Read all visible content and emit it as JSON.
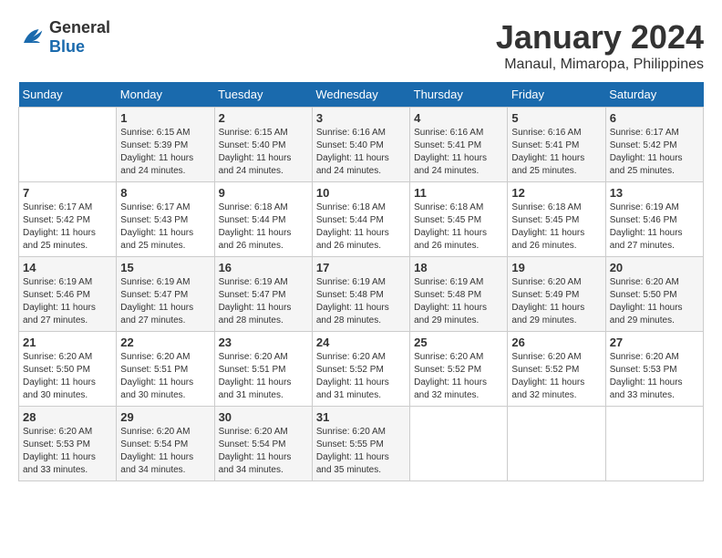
{
  "header": {
    "logo_general": "General",
    "logo_blue": "Blue",
    "month_title": "January 2024",
    "location": "Manaul, Mimaropa, Philippines"
  },
  "days_of_week": [
    "Sunday",
    "Monday",
    "Tuesday",
    "Wednesday",
    "Thursday",
    "Friday",
    "Saturday"
  ],
  "weeks": [
    [
      {
        "num": "",
        "sunrise": "",
        "sunset": "",
        "daylight": ""
      },
      {
        "num": "1",
        "sunrise": "6:15 AM",
        "sunset": "5:39 PM",
        "daylight": "11 hours and 24 minutes."
      },
      {
        "num": "2",
        "sunrise": "6:15 AM",
        "sunset": "5:40 PM",
        "daylight": "11 hours and 24 minutes."
      },
      {
        "num": "3",
        "sunrise": "6:16 AM",
        "sunset": "5:40 PM",
        "daylight": "11 hours and 24 minutes."
      },
      {
        "num": "4",
        "sunrise": "6:16 AM",
        "sunset": "5:41 PM",
        "daylight": "11 hours and 24 minutes."
      },
      {
        "num": "5",
        "sunrise": "6:16 AM",
        "sunset": "5:41 PM",
        "daylight": "11 hours and 25 minutes."
      },
      {
        "num": "6",
        "sunrise": "6:17 AM",
        "sunset": "5:42 PM",
        "daylight": "11 hours and 25 minutes."
      }
    ],
    [
      {
        "num": "7",
        "sunrise": "6:17 AM",
        "sunset": "5:42 PM",
        "daylight": "11 hours and 25 minutes."
      },
      {
        "num": "8",
        "sunrise": "6:17 AM",
        "sunset": "5:43 PM",
        "daylight": "11 hours and 25 minutes."
      },
      {
        "num": "9",
        "sunrise": "6:18 AM",
        "sunset": "5:44 PM",
        "daylight": "11 hours and 26 minutes."
      },
      {
        "num": "10",
        "sunrise": "6:18 AM",
        "sunset": "5:44 PM",
        "daylight": "11 hours and 26 minutes."
      },
      {
        "num": "11",
        "sunrise": "6:18 AM",
        "sunset": "5:45 PM",
        "daylight": "11 hours and 26 minutes."
      },
      {
        "num": "12",
        "sunrise": "6:18 AM",
        "sunset": "5:45 PM",
        "daylight": "11 hours and 26 minutes."
      },
      {
        "num": "13",
        "sunrise": "6:19 AM",
        "sunset": "5:46 PM",
        "daylight": "11 hours and 27 minutes."
      }
    ],
    [
      {
        "num": "14",
        "sunrise": "6:19 AM",
        "sunset": "5:46 PM",
        "daylight": "11 hours and 27 minutes."
      },
      {
        "num": "15",
        "sunrise": "6:19 AM",
        "sunset": "5:47 PM",
        "daylight": "11 hours and 27 minutes."
      },
      {
        "num": "16",
        "sunrise": "6:19 AM",
        "sunset": "5:47 PM",
        "daylight": "11 hours and 28 minutes."
      },
      {
        "num": "17",
        "sunrise": "6:19 AM",
        "sunset": "5:48 PM",
        "daylight": "11 hours and 28 minutes."
      },
      {
        "num": "18",
        "sunrise": "6:19 AM",
        "sunset": "5:48 PM",
        "daylight": "11 hours and 29 minutes."
      },
      {
        "num": "19",
        "sunrise": "6:20 AM",
        "sunset": "5:49 PM",
        "daylight": "11 hours and 29 minutes."
      },
      {
        "num": "20",
        "sunrise": "6:20 AM",
        "sunset": "5:50 PM",
        "daylight": "11 hours and 29 minutes."
      }
    ],
    [
      {
        "num": "21",
        "sunrise": "6:20 AM",
        "sunset": "5:50 PM",
        "daylight": "11 hours and 30 minutes."
      },
      {
        "num": "22",
        "sunrise": "6:20 AM",
        "sunset": "5:51 PM",
        "daylight": "11 hours and 30 minutes."
      },
      {
        "num": "23",
        "sunrise": "6:20 AM",
        "sunset": "5:51 PM",
        "daylight": "11 hours and 31 minutes."
      },
      {
        "num": "24",
        "sunrise": "6:20 AM",
        "sunset": "5:52 PM",
        "daylight": "11 hours and 31 minutes."
      },
      {
        "num": "25",
        "sunrise": "6:20 AM",
        "sunset": "5:52 PM",
        "daylight": "11 hours and 32 minutes."
      },
      {
        "num": "26",
        "sunrise": "6:20 AM",
        "sunset": "5:52 PM",
        "daylight": "11 hours and 32 minutes."
      },
      {
        "num": "27",
        "sunrise": "6:20 AM",
        "sunset": "5:53 PM",
        "daylight": "11 hours and 33 minutes."
      }
    ],
    [
      {
        "num": "28",
        "sunrise": "6:20 AM",
        "sunset": "5:53 PM",
        "daylight": "11 hours and 33 minutes."
      },
      {
        "num": "29",
        "sunrise": "6:20 AM",
        "sunset": "5:54 PM",
        "daylight": "11 hours and 34 minutes."
      },
      {
        "num": "30",
        "sunrise": "6:20 AM",
        "sunset": "5:54 PM",
        "daylight": "11 hours and 34 minutes."
      },
      {
        "num": "31",
        "sunrise": "6:20 AM",
        "sunset": "5:55 PM",
        "daylight": "11 hours and 35 minutes."
      },
      {
        "num": "",
        "sunrise": "",
        "sunset": "",
        "daylight": ""
      },
      {
        "num": "",
        "sunrise": "",
        "sunset": "",
        "daylight": ""
      },
      {
        "num": "",
        "sunrise": "",
        "sunset": "",
        "daylight": ""
      }
    ]
  ]
}
